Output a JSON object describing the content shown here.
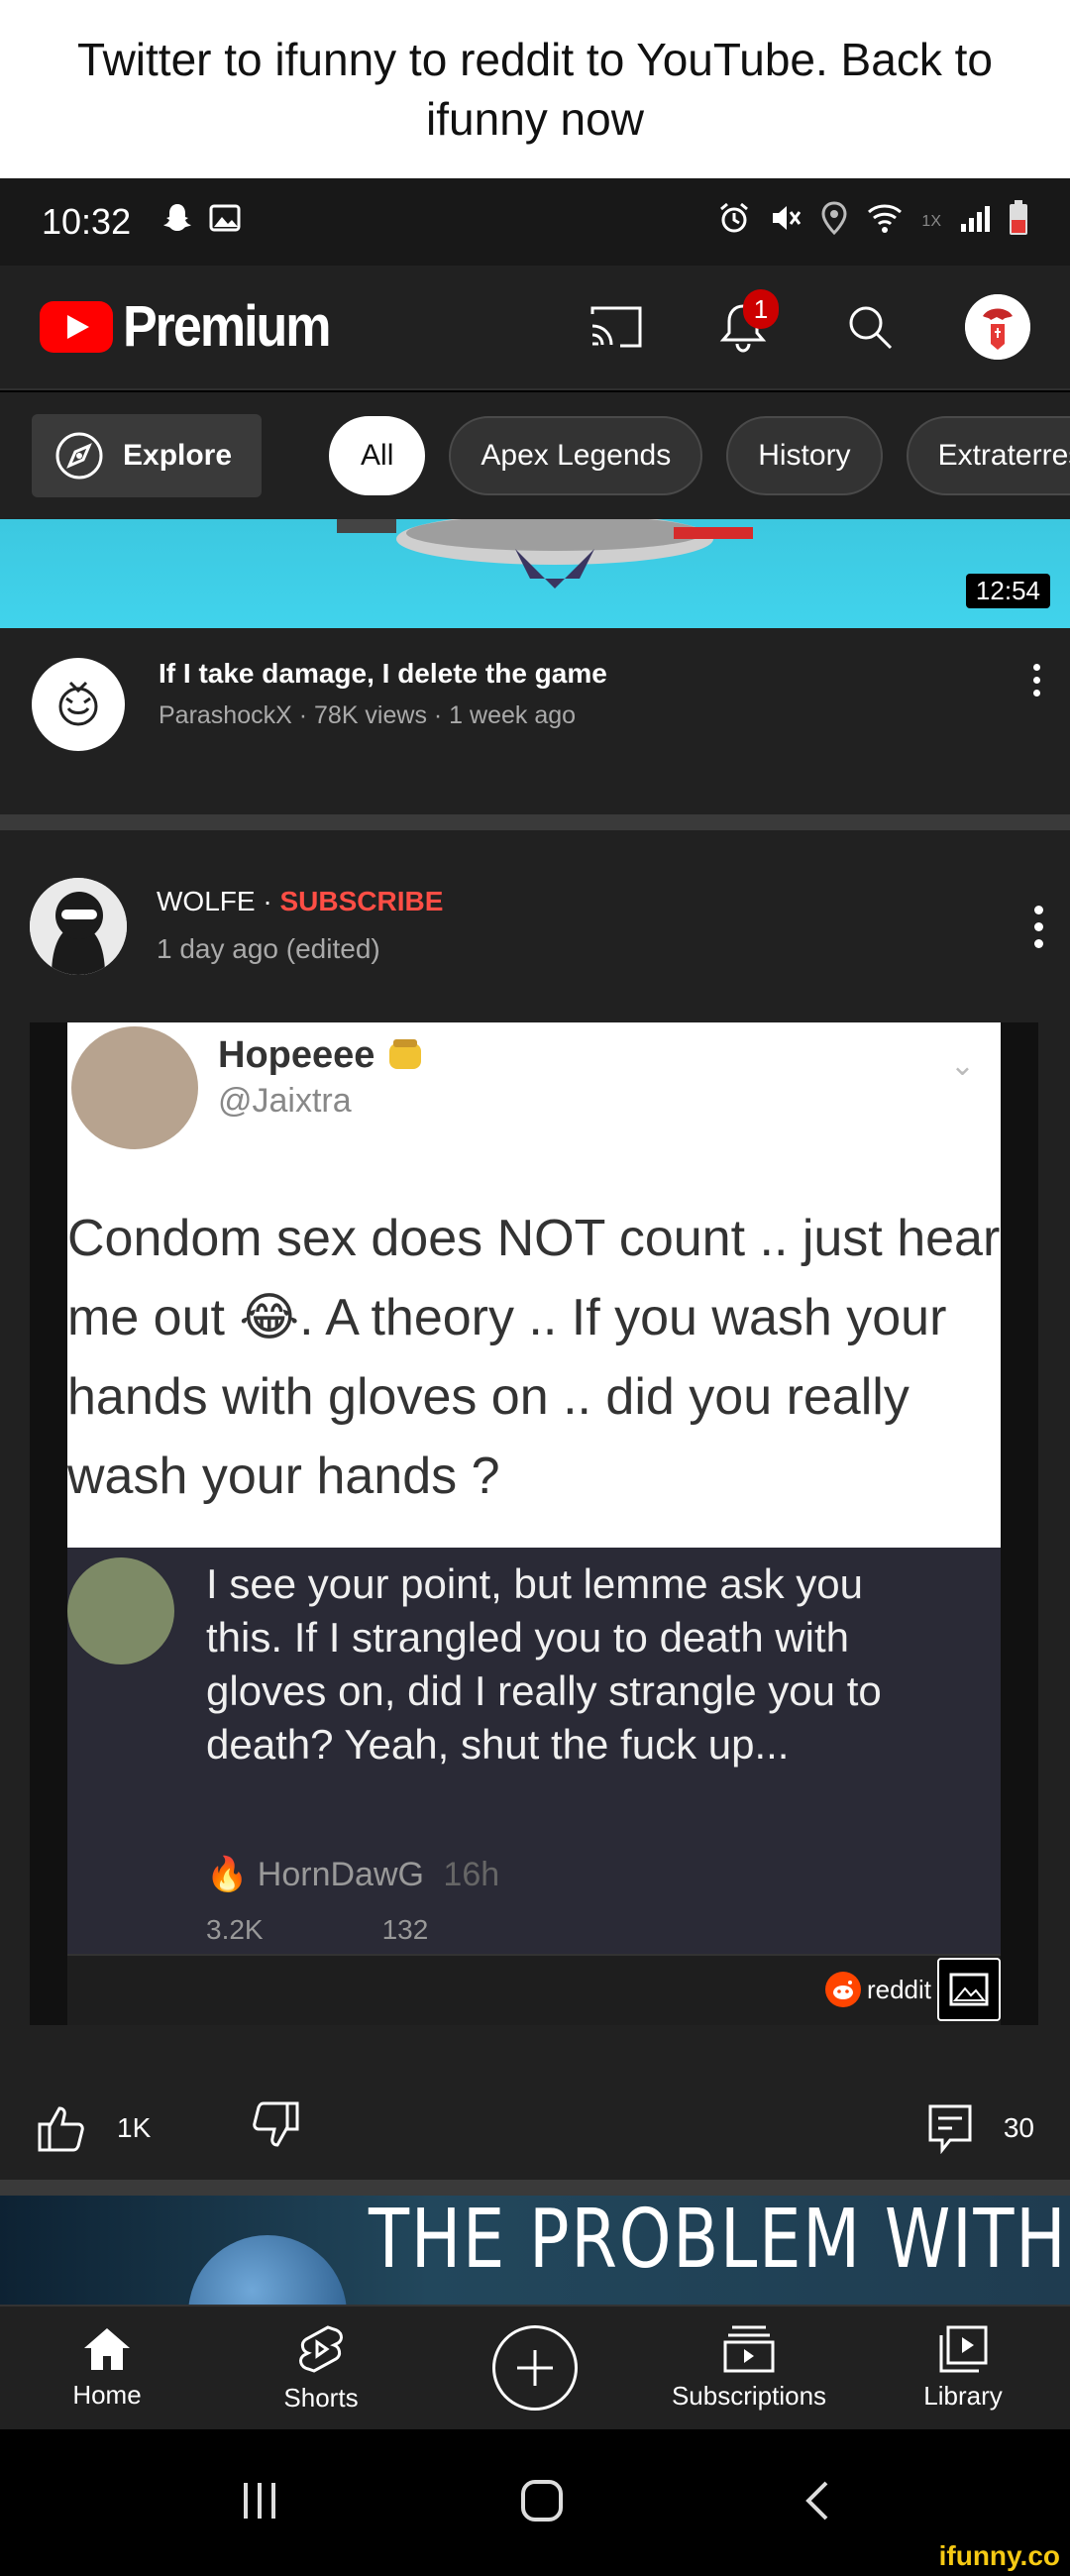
{
  "caption": "Twitter to ifunny to reddit to YouTube. Back to ifunny now",
  "status_bar": {
    "time": "10:32",
    "signal_label": "1X"
  },
  "app_bar": {
    "logo_text": "Premium",
    "notification_count": "1"
  },
  "chips": {
    "explore": "Explore",
    "items": [
      "All",
      "Apex Legends",
      "History",
      "Extraterrestria"
    ]
  },
  "video1": {
    "duration": "12:54",
    "title": "If I take damage, I delete the game",
    "meta": "ParashockX · 78K views · 1 week ago"
  },
  "post": {
    "author": "WOLFE ·",
    "subscribe": "SUBSCRIBE",
    "time": "1 day ago (edited)",
    "tweet": {
      "name": "Hopeeee",
      "handle": "@Jaixtra",
      "text": "Condom sex does NOT count .. just hear me out 😂. A theory .. If you wash your hands with gloves on .. did you really wash your hands ?"
    },
    "reply": {
      "text": "I see your point, but lemme ask you this. If I strangled you to death with gloves on, did I really strangle you to death? Yeah, shut the fuck up...",
      "user": "HornDawG",
      "age": "16h",
      "reactions": "3.2K",
      "replies": "132"
    },
    "source_tag": "reddit",
    "likes": "1K",
    "comments": "30"
  },
  "video2": {
    "title_text": "THE PROBLEM WITH"
  },
  "bottom_nav": {
    "home": "Home",
    "shorts": "Shorts",
    "subscriptions": "Subscriptions",
    "library": "Library"
  },
  "watermark": "ifunny.co",
  "colors": {
    "youtube_red": "#ff0000",
    "subscribe_red": "#ff4e45",
    "background": "#212121",
    "reddit_orange": "#ff4500"
  }
}
